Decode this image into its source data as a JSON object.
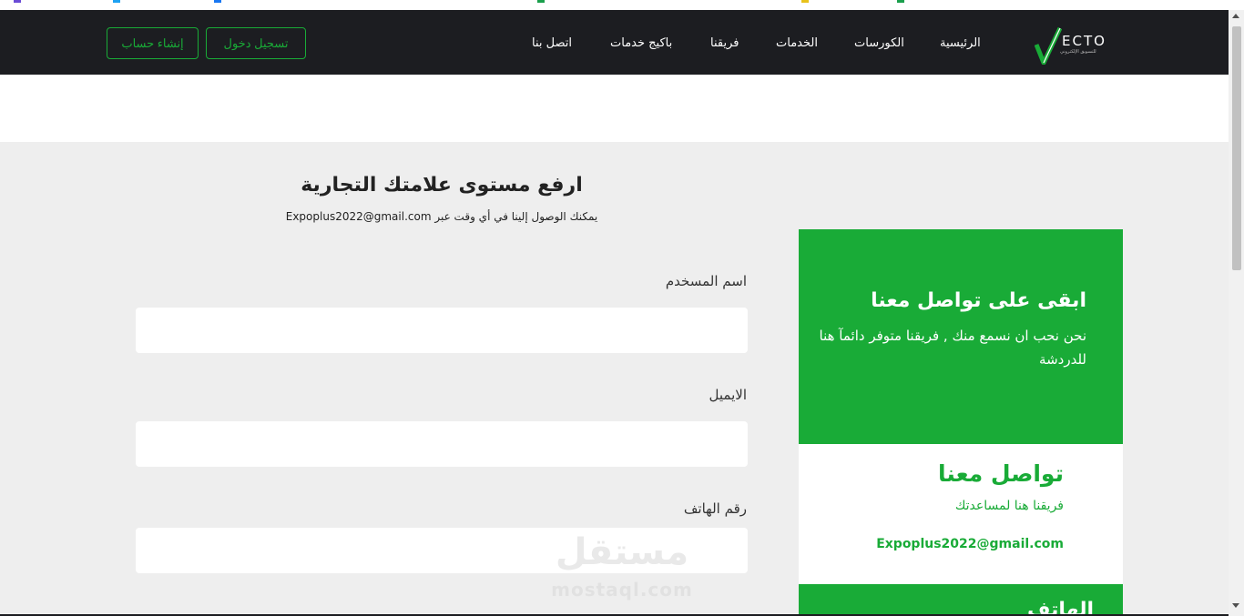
{
  "nav": {
    "logo_text": "ECTO",
    "logo_sub": "للتسويق الإلكتروني",
    "links": [
      "الرئيسية",
      "الكورسات",
      "الخدمات",
      "فريقنا",
      "باكيج خدمات",
      "اتصل بنا"
    ],
    "login_label": "تسجيل دخول",
    "signup_label": "إنشاء حساب"
  },
  "form": {
    "title": "ارفع مستوى علامتك التجارية",
    "subtitle": "يمكنك الوصول إلينا في أي وقت عبر Expoplus2022@gmail.com",
    "fields": [
      {
        "label": "اسم المسخدم",
        "value": ""
      },
      {
        "label": "الايميل",
        "value": ""
      },
      {
        "label": "رقم الهاتف",
        "value": ""
      }
    ]
  },
  "contact_card": {
    "title": "ابقى على تواصل معنا",
    "text": "نحن نحب ان نسمع منك , فريقنا متوفر دائمآ هنا للدردشة"
  },
  "info_card": {
    "title": "تواصل معنا",
    "subtitle": "فريقنا هنا لمساعدتك",
    "email": "Expoplus2022@gmail.com"
  },
  "phone_card": {
    "title": "الهاتف"
  },
  "watermark": {
    "arabic": "مستقل",
    "latin": "mostaql.com"
  },
  "colors": {
    "accent": "#19ab37",
    "nav_bg": "#1c1d21",
    "page_bg": "#eeeeee"
  }
}
